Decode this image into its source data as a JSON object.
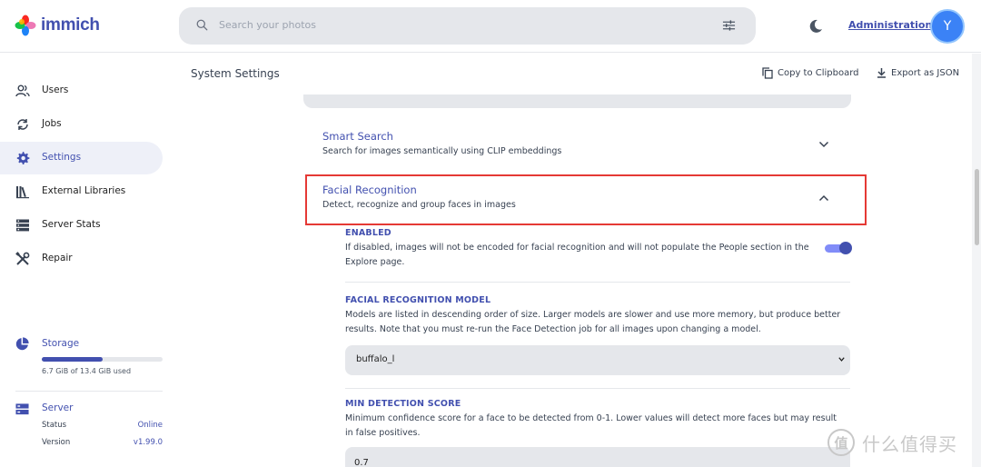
{
  "header": {
    "app_name": "immich",
    "search_placeholder": "Search your photos",
    "admin_link": "Administration",
    "avatar_initial": "Y"
  },
  "sidebar": {
    "items": [
      {
        "label": "Users",
        "icon": "users-icon"
      },
      {
        "label": "Jobs",
        "icon": "sync-icon"
      },
      {
        "label": "Settings",
        "icon": "gear-icon",
        "active": true
      },
      {
        "label": "External Libraries",
        "icon": "library-icon"
      },
      {
        "label": "Server Stats",
        "icon": "server-icon"
      },
      {
        "label": "Repair",
        "icon": "tools-icon"
      }
    ],
    "storage": {
      "title": "Storage",
      "used_text": "6.7 GiB of 13.4 GiB used",
      "used_fraction": 0.5
    },
    "server": {
      "title": "Server",
      "status_label": "Status",
      "status_value": "Online",
      "version_label": "Version",
      "version_value": "v1.99.0"
    }
  },
  "toolbar": {
    "page_title": "System Settings",
    "copy_label": "Copy to Clipboard",
    "export_label": "Export as JSON"
  },
  "sections": {
    "smart_search": {
      "title": "Smart Search",
      "subtitle": "Search for images semantically using CLIP embeddings"
    },
    "facial_recognition": {
      "title": "Facial Recognition",
      "subtitle": "Detect, recognize and group faces in images"
    }
  },
  "settings": {
    "enabled": {
      "label": "ENABLED",
      "desc_line1": "If disabled, images will not be encoded for facial recognition and will not populate the People section in the",
      "desc_line2": "Explore page.",
      "on": true
    },
    "model": {
      "label": "FACIAL RECOGNITION MODEL",
      "desc_line1": "Models are listed in descending order of size. Larger models are slower and use more memory, but produce better",
      "desc_line2": "results. Note that you must re-run the Face Detection job for all images upon changing a model.",
      "value": "buffalo_l"
    },
    "min_score": {
      "label": "MIN DETECTION SCORE",
      "desc_line1": "Minimum confidence score for a face to be detected from 0-1. Lower values will detect more faces but may result",
      "desc_line2": "in false positives.",
      "value": "0.7"
    }
  },
  "watermark": {
    "badge": "值",
    "text": "什么值得买"
  },
  "colors": {
    "accent": "#4250af",
    "highlight_border": "#e53935"
  }
}
